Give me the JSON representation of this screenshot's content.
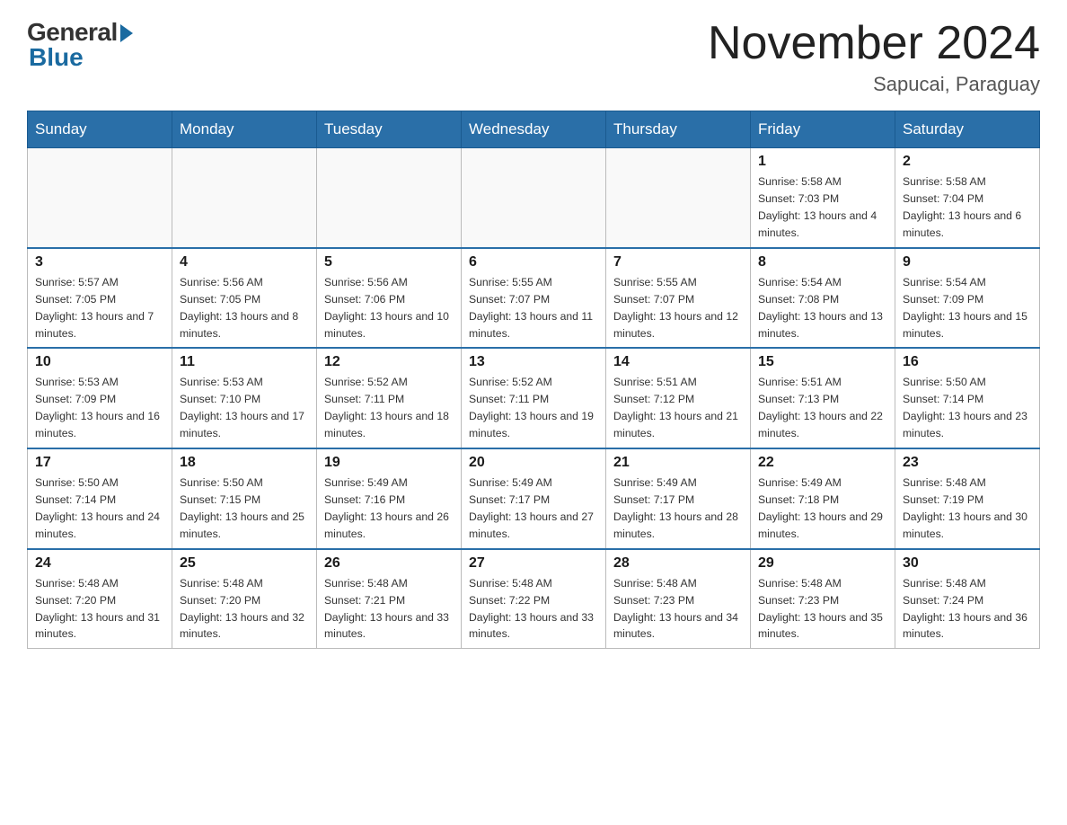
{
  "header": {
    "logo_general": "General",
    "logo_blue": "Blue",
    "month_title": "November 2024",
    "location": "Sapucai, Paraguay"
  },
  "weekdays": [
    "Sunday",
    "Monday",
    "Tuesday",
    "Wednesday",
    "Thursday",
    "Friday",
    "Saturday"
  ],
  "weeks": [
    [
      {
        "day": "",
        "sunrise": "",
        "sunset": "",
        "daylight": ""
      },
      {
        "day": "",
        "sunrise": "",
        "sunset": "",
        "daylight": ""
      },
      {
        "day": "",
        "sunrise": "",
        "sunset": "",
        "daylight": ""
      },
      {
        "day": "",
        "sunrise": "",
        "sunset": "",
        "daylight": ""
      },
      {
        "day": "",
        "sunrise": "",
        "sunset": "",
        "daylight": ""
      },
      {
        "day": "1",
        "sunrise": "Sunrise: 5:58 AM",
        "sunset": "Sunset: 7:03 PM",
        "daylight": "Daylight: 13 hours and 4 minutes."
      },
      {
        "day": "2",
        "sunrise": "Sunrise: 5:58 AM",
        "sunset": "Sunset: 7:04 PM",
        "daylight": "Daylight: 13 hours and 6 minutes."
      }
    ],
    [
      {
        "day": "3",
        "sunrise": "Sunrise: 5:57 AM",
        "sunset": "Sunset: 7:05 PM",
        "daylight": "Daylight: 13 hours and 7 minutes."
      },
      {
        "day": "4",
        "sunrise": "Sunrise: 5:56 AM",
        "sunset": "Sunset: 7:05 PM",
        "daylight": "Daylight: 13 hours and 8 minutes."
      },
      {
        "day": "5",
        "sunrise": "Sunrise: 5:56 AM",
        "sunset": "Sunset: 7:06 PM",
        "daylight": "Daylight: 13 hours and 10 minutes."
      },
      {
        "day": "6",
        "sunrise": "Sunrise: 5:55 AM",
        "sunset": "Sunset: 7:07 PM",
        "daylight": "Daylight: 13 hours and 11 minutes."
      },
      {
        "day": "7",
        "sunrise": "Sunrise: 5:55 AM",
        "sunset": "Sunset: 7:07 PM",
        "daylight": "Daylight: 13 hours and 12 minutes."
      },
      {
        "day": "8",
        "sunrise": "Sunrise: 5:54 AM",
        "sunset": "Sunset: 7:08 PM",
        "daylight": "Daylight: 13 hours and 13 minutes."
      },
      {
        "day": "9",
        "sunrise": "Sunrise: 5:54 AM",
        "sunset": "Sunset: 7:09 PM",
        "daylight": "Daylight: 13 hours and 15 minutes."
      }
    ],
    [
      {
        "day": "10",
        "sunrise": "Sunrise: 5:53 AM",
        "sunset": "Sunset: 7:09 PM",
        "daylight": "Daylight: 13 hours and 16 minutes."
      },
      {
        "day": "11",
        "sunrise": "Sunrise: 5:53 AM",
        "sunset": "Sunset: 7:10 PM",
        "daylight": "Daylight: 13 hours and 17 minutes."
      },
      {
        "day": "12",
        "sunrise": "Sunrise: 5:52 AM",
        "sunset": "Sunset: 7:11 PM",
        "daylight": "Daylight: 13 hours and 18 minutes."
      },
      {
        "day": "13",
        "sunrise": "Sunrise: 5:52 AM",
        "sunset": "Sunset: 7:11 PM",
        "daylight": "Daylight: 13 hours and 19 minutes."
      },
      {
        "day": "14",
        "sunrise": "Sunrise: 5:51 AM",
        "sunset": "Sunset: 7:12 PM",
        "daylight": "Daylight: 13 hours and 21 minutes."
      },
      {
        "day": "15",
        "sunrise": "Sunrise: 5:51 AM",
        "sunset": "Sunset: 7:13 PM",
        "daylight": "Daylight: 13 hours and 22 minutes."
      },
      {
        "day": "16",
        "sunrise": "Sunrise: 5:50 AM",
        "sunset": "Sunset: 7:14 PM",
        "daylight": "Daylight: 13 hours and 23 minutes."
      }
    ],
    [
      {
        "day": "17",
        "sunrise": "Sunrise: 5:50 AM",
        "sunset": "Sunset: 7:14 PM",
        "daylight": "Daylight: 13 hours and 24 minutes."
      },
      {
        "day": "18",
        "sunrise": "Sunrise: 5:50 AM",
        "sunset": "Sunset: 7:15 PM",
        "daylight": "Daylight: 13 hours and 25 minutes."
      },
      {
        "day": "19",
        "sunrise": "Sunrise: 5:49 AM",
        "sunset": "Sunset: 7:16 PM",
        "daylight": "Daylight: 13 hours and 26 minutes."
      },
      {
        "day": "20",
        "sunrise": "Sunrise: 5:49 AM",
        "sunset": "Sunset: 7:17 PM",
        "daylight": "Daylight: 13 hours and 27 minutes."
      },
      {
        "day": "21",
        "sunrise": "Sunrise: 5:49 AM",
        "sunset": "Sunset: 7:17 PM",
        "daylight": "Daylight: 13 hours and 28 minutes."
      },
      {
        "day": "22",
        "sunrise": "Sunrise: 5:49 AM",
        "sunset": "Sunset: 7:18 PM",
        "daylight": "Daylight: 13 hours and 29 minutes."
      },
      {
        "day": "23",
        "sunrise": "Sunrise: 5:48 AM",
        "sunset": "Sunset: 7:19 PM",
        "daylight": "Daylight: 13 hours and 30 minutes."
      }
    ],
    [
      {
        "day": "24",
        "sunrise": "Sunrise: 5:48 AM",
        "sunset": "Sunset: 7:20 PM",
        "daylight": "Daylight: 13 hours and 31 minutes."
      },
      {
        "day": "25",
        "sunrise": "Sunrise: 5:48 AM",
        "sunset": "Sunset: 7:20 PM",
        "daylight": "Daylight: 13 hours and 32 minutes."
      },
      {
        "day": "26",
        "sunrise": "Sunrise: 5:48 AM",
        "sunset": "Sunset: 7:21 PM",
        "daylight": "Daylight: 13 hours and 33 minutes."
      },
      {
        "day": "27",
        "sunrise": "Sunrise: 5:48 AM",
        "sunset": "Sunset: 7:22 PM",
        "daylight": "Daylight: 13 hours and 33 minutes."
      },
      {
        "day": "28",
        "sunrise": "Sunrise: 5:48 AM",
        "sunset": "Sunset: 7:23 PM",
        "daylight": "Daylight: 13 hours and 34 minutes."
      },
      {
        "day": "29",
        "sunrise": "Sunrise: 5:48 AM",
        "sunset": "Sunset: 7:23 PM",
        "daylight": "Daylight: 13 hours and 35 minutes."
      },
      {
        "day": "30",
        "sunrise": "Sunrise: 5:48 AM",
        "sunset": "Sunset: 7:24 PM",
        "daylight": "Daylight: 13 hours and 36 minutes."
      }
    ]
  ]
}
